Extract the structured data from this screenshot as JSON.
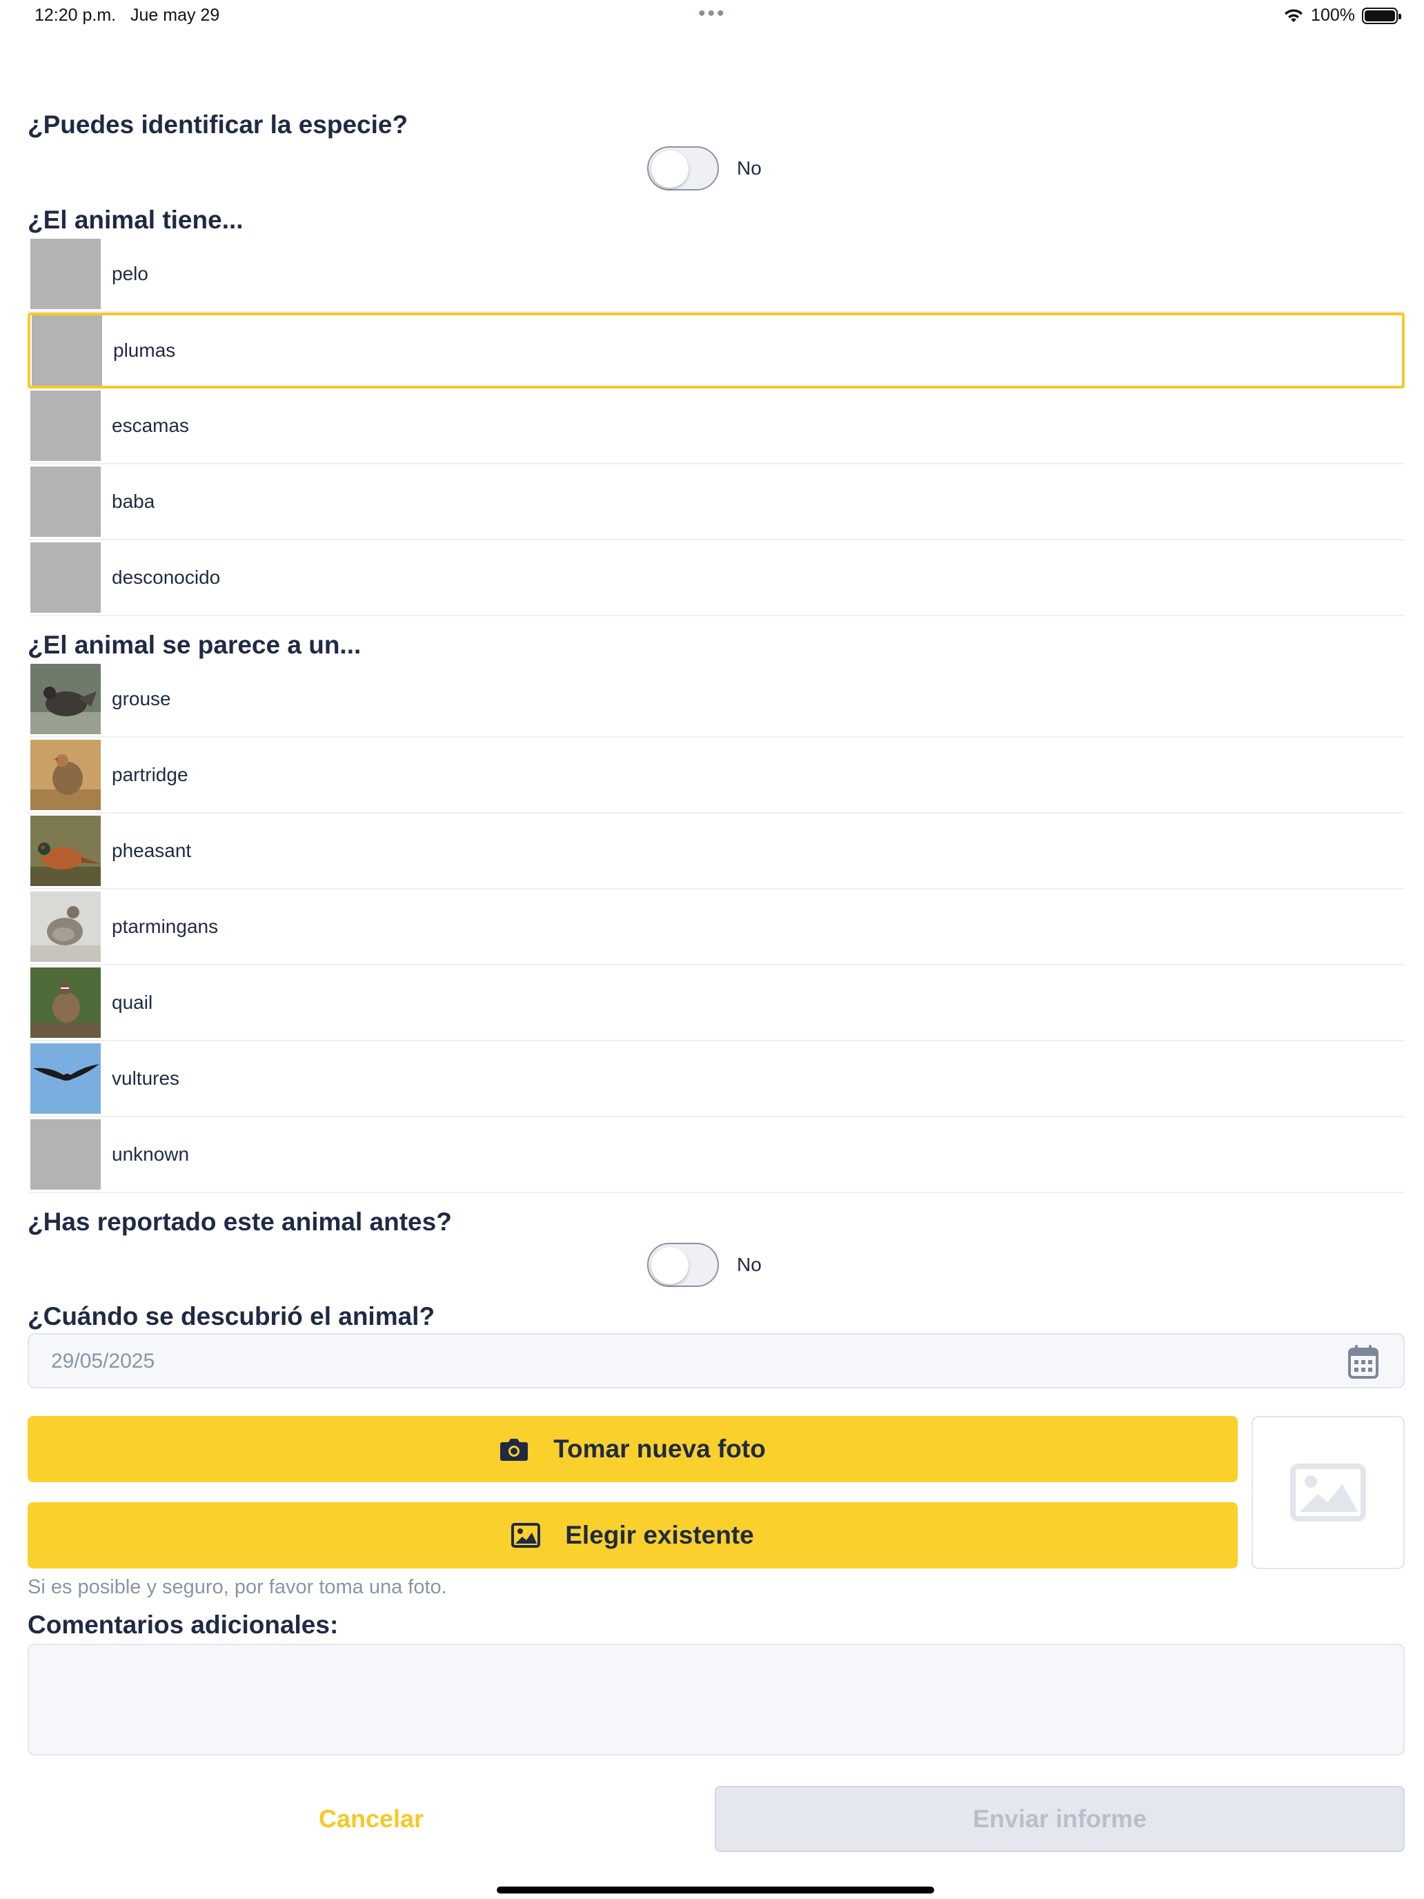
{
  "status_bar": {
    "time": "12:20 p.m.",
    "date": "Jue may 29",
    "battery": "100%",
    "icons": [
      "wifi-icon",
      "battery-icon",
      "more-dots-icon"
    ]
  },
  "identify_species": {
    "question": "¿Puedes identificar la especie?",
    "toggle_label": "No",
    "toggle_on": false
  },
  "covering": {
    "question": "¿El animal tiene...",
    "items": [
      {
        "label": "pelo",
        "selected": false
      },
      {
        "label": "plumas",
        "selected": true
      },
      {
        "label": "escamas",
        "selected": false
      },
      {
        "label": "baba",
        "selected": false
      },
      {
        "label": "desconocido",
        "selected": false
      }
    ]
  },
  "resembles": {
    "question": "¿El animal se parece a un...",
    "items": [
      {
        "label": "grouse",
        "icon": "grouse-photo"
      },
      {
        "label": "partridge",
        "icon": "partridge-photo"
      },
      {
        "label": "pheasant",
        "icon": "pheasant-photo"
      },
      {
        "label": "ptarmingans",
        "icon": "ptarmigan-photo"
      },
      {
        "label": "quail",
        "icon": "quail-photo"
      },
      {
        "label": "vultures",
        "icon": "vulture-photo"
      },
      {
        "label": "unknown",
        "icon": "placeholder"
      }
    ]
  },
  "reported_before": {
    "question": "¿Has reportado este animal antes?",
    "toggle_label": "No",
    "toggle_on": false
  },
  "discovered": {
    "question": "¿Cuándo se descubrió el animal?",
    "date_value": "29/05/2025"
  },
  "photo": {
    "take_new_label": "Tomar nueva foto",
    "choose_existing_label": "Elegir existente",
    "hint": "Si es posible y seguro, por favor toma una foto."
  },
  "comments": {
    "label": "Comentarios adicionales:",
    "value": ""
  },
  "actions": {
    "cancel_label": "Cancelar",
    "submit_label": "Enviar informe"
  },
  "colors": {
    "accent": "#fad02c",
    "selected_border": "#f6c928",
    "text": "#1f2a44",
    "muted": "#8a94a6",
    "disabled_bg": "#e4e7ee"
  }
}
